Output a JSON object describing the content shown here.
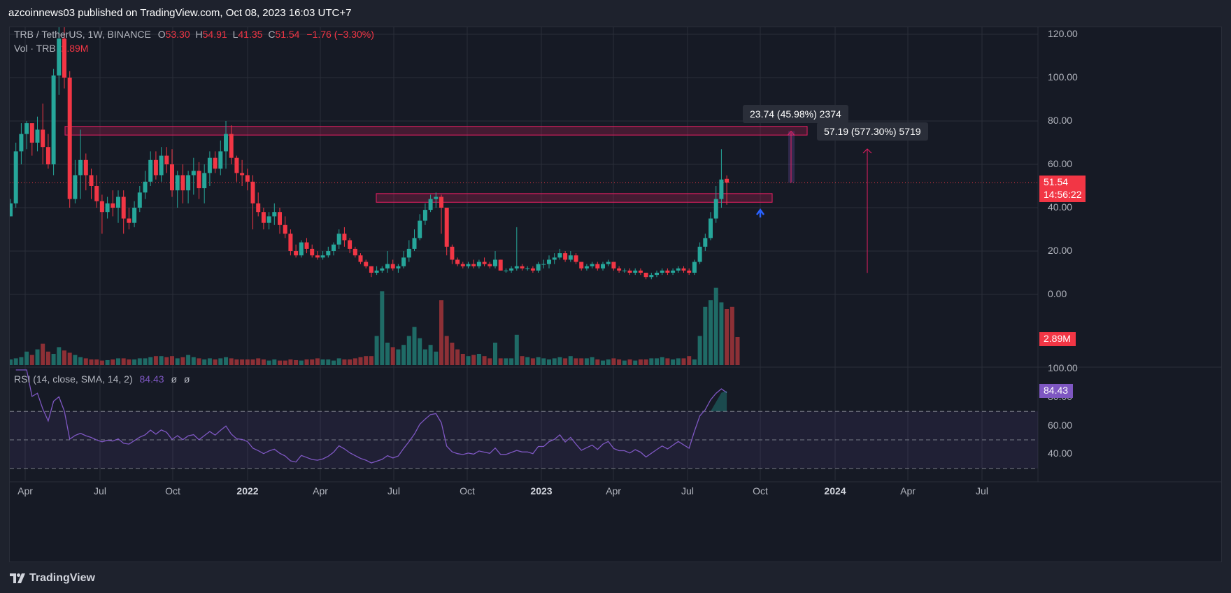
{
  "header": {
    "publisher_text": "azcoinnews03 published on TradingView.com, Oct 08, 2023 16:03 UTC+7"
  },
  "legend": {
    "symbol": "TRB / TetherUS, 1W, BINANCE",
    "o_label": "O",
    "o_value": "53.30",
    "h_label": "H",
    "h_value": "54.91",
    "l_label": "L",
    "l_value": "41.35",
    "c_label": "C",
    "c_value": "51.54",
    "change": "−1.76 (−3.30%)",
    "vol_label": "Vol · TRB",
    "vol_value": "2.89M"
  },
  "rsi_legend": {
    "label": "RSI (14, close, SMA, 14, 2)",
    "value": "84.43",
    "extra1": "ø",
    "extra2": "ø"
  },
  "price_axis": [
    "120.00",
    "100.00",
    "80.00",
    "60.00",
    "40.00",
    "20.00",
    "0.00"
  ],
  "rsi_axis": [
    "100.00",
    "80.00",
    "60.00",
    "40.00"
  ],
  "time_axis": [
    {
      "label": "Apr",
      "bold": false
    },
    {
      "label": "Jul",
      "bold": false
    },
    {
      "label": "Oct",
      "bold": false
    },
    {
      "label": "2022",
      "bold": true
    },
    {
      "label": "Apr",
      "bold": false
    },
    {
      "label": "Jul",
      "bold": false
    },
    {
      "label": "Oct",
      "bold": false
    },
    {
      "label": "2023",
      "bold": true
    },
    {
      "label": "Apr",
      "bold": false
    },
    {
      "label": "Jul",
      "bold": false
    },
    {
      "label": "Oct",
      "bold": false
    },
    {
      "label": "2024",
      "bold": true
    },
    {
      "label": "Apr",
      "bold": false
    },
    {
      "label": "Jul",
      "bold": false
    }
  ],
  "tags": {
    "last_price": "51.54",
    "countdown": "14:56:22",
    "volume": "2.89M",
    "rsi": "84.43"
  },
  "tooltips": {
    "measure1": "23.74 (45.98%) 2374",
    "measure2": "57.19 (577.30%) 5719"
  },
  "footer": {
    "brand": "TradingView"
  },
  "colors": {
    "up": "#26a69a",
    "down": "#f23645",
    "up_vol": "#1f6b66",
    "down_vol": "#8d3036",
    "zone": "#e91e63",
    "rsi_line": "#7e57c2",
    "background": "#161a25"
  },
  "chart_data": {
    "type": "candlestick",
    "symbol": "TRB / TetherUS",
    "interval": "1W",
    "exchange": "BINANCE",
    "price_range": [
      -10,
      125
    ],
    "rsi_range": [
      30,
      100
    ],
    "last": {
      "open": 53.3,
      "high": 54.91,
      "low": 41.35,
      "close": 51.54,
      "change": -1.76,
      "change_pct": -3.3,
      "volume": "2.89M",
      "rsi": 84.43
    },
    "resistance_zones": [
      {
        "low": 73.5,
        "high": 77.5
      },
      {
        "low": 42.5,
        "high": 46.5
      }
    ],
    "measures": [
      {
        "from": 51.54,
        "to": 75.28,
        "change": 23.74,
        "pct": 45.98,
        "label": "23.74 (45.98%) 2374"
      },
      {
        "from": 9.9,
        "to": 67.1,
        "change": 57.19,
        "pct": 577.3,
        "label": "57.19 (577.30%) 5719"
      }
    ],
    "rsi_levels": {
      "upper": 70,
      "middle": 50,
      "lower": 30
    },
    "candles": [
      [
        36,
        44,
        36,
        42
      ],
      [
        42,
        70,
        40,
        66
      ],
      [
        66,
        79,
        60,
        74
      ],
      [
        74,
        80,
        67,
        79
      ],
      [
        79,
        78,
        64,
        70
      ],
      [
        70,
        82,
        66,
        76
      ],
      [
        76,
        88,
        60,
        68
      ],
      [
        68,
        74,
        58,
        60
      ],
      [
        60,
        104,
        55,
        101
      ],
      [
        101,
        125,
        92,
        118
      ],
      [
        118,
        124,
        95,
        100
      ],
      [
        100,
        103,
        40,
        44
      ],
      [
        44,
        62,
        42,
        55
      ],
      [
        55,
        76,
        44,
        62
      ],
      [
        62,
        65,
        48,
        55
      ],
      [
        55,
        58,
        44,
        50
      ],
      [
        50,
        55,
        40,
        43
      ],
      [
        43,
        46,
        28,
        38
      ],
      [
        38,
        45,
        35,
        42
      ],
      [
        42,
        48,
        36,
        40
      ],
      [
        40,
        48,
        33,
        45
      ],
      [
        45,
        48,
        28,
        35
      ],
      [
        35,
        40,
        30,
        33
      ],
      [
        33,
        43,
        31,
        40
      ],
      [
        40,
        50,
        38,
        47
      ],
      [
        47,
        57,
        44,
        52
      ],
      [
        52,
        66,
        50,
        62
      ],
      [
        62,
        66,
        53,
        55
      ],
      [
        55,
        68,
        52,
        64
      ],
      [
        64,
        68,
        56,
        60
      ],
      [
        60,
        67,
        45,
        48
      ],
      [
        48,
        57,
        40,
        55
      ],
      [
        55,
        60,
        42,
        48
      ],
      [
        48,
        57,
        42,
        55
      ],
      [
        55,
        63,
        46,
        57
      ],
      [
        57,
        61,
        44,
        49
      ],
      [
        49,
        60,
        42,
        56
      ],
      [
        56,
        66,
        50,
        63
      ],
      [
        63,
        66,
        56,
        58
      ],
      [
        58,
        71,
        55,
        66
      ],
      [
        66,
        80,
        58,
        74
      ],
      [
        74,
        78,
        60,
        63
      ],
      [
        63,
        64,
        52,
        56
      ],
      [
        56,
        62,
        50,
        55
      ],
      [
        55,
        58,
        48,
        52
      ],
      [
        52,
        55,
        30,
        42
      ],
      [
        42,
        47,
        36,
        38
      ],
      [
        38,
        40,
        30,
        33
      ],
      [
        33,
        38,
        30,
        36
      ],
      [
        36,
        42,
        32,
        38
      ],
      [
        38,
        40,
        28,
        32
      ],
      [
        32,
        36,
        26,
        28
      ],
      [
        28,
        30,
        18,
        20
      ],
      [
        20,
        23,
        17,
        18
      ],
      [
        18,
        25,
        17,
        24
      ],
      [
        24,
        26,
        19,
        21
      ],
      [
        21,
        23,
        17,
        18
      ],
      [
        18,
        20,
        16,
        17
      ],
      [
        17,
        20,
        16,
        18
      ],
      [
        18,
        22,
        17,
        20
      ],
      [
        20,
        24,
        18,
        23
      ],
      [
        23,
        30,
        21,
        28
      ],
      [
        28,
        31,
        22,
        25
      ],
      [
        25,
        26,
        19,
        21
      ],
      [
        21,
        22,
        17,
        18
      ],
      [
        18,
        19,
        14,
        15
      ],
      [
        15,
        16,
        12,
        13
      ],
      [
        13,
        13,
        8,
        10
      ],
      [
        10,
        13,
        9,
        11
      ],
      [
        11,
        13,
        10,
        12
      ],
      [
        12,
        20,
        10,
        14
      ],
      [
        14,
        16,
        11,
        12
      ],
      [
        12,
        14,
        10,
        13
      ],
      [
        13,
        20,
        12,
        17
      ],
      [
        17,
        25,
        15,
        21
      ],
      [
        21,
        30,
        20,
        26
      ],
      [
        26,
        37,
        25,
        34
      ],
      [
        34,
        42,
        32,
        39
      ],
      [
        39,
        46,
        38,
        44
      ],
      [
        44,
        47,
        40,
        45
      ],
      [
        45,
        46,
        28,
        40
      ],
      [
        40,
        40,
        18,
        22
      ],
      [
        22,
        23,
        14,
        16
      ],
      [
        16,
        17,
        13,
        14
      ],
      [
        14,
        15,
        12,
        13
      ],
      [
        13,
        15,
        12,
        14
      ],
      [
        14,
        16,
        12,
        13
      ],
      [
        13,
        16,
        12,
        15
      ],
      [
        15,
        17,
        13,
        14
      ],
      [
        14,
        15,
        12,
        13
      ],
      [
        13,
        20,
        12,
        16
      ],
      [
        16,
        16,
        11,
        11
      ],
      [
        11,
        12,
        10,
        11
      ],
      [
        11,
        13,
        10,
        12
      ],
      [
        12,
        31,
        11,
        13
      ],
      [
        13,
        14,
        11,
        12
      ],
      [
        12,
        13,
        11,
        12
      ],
      [
        12,
        13,
        10,
        11
      ],
      [
        11,
        15,
        10,
        14
      ],
      [
        14,
        16,
        12,
        14
      ],
      [
        14,
        18,
        12,
        16
      ],
      [
        16,
        19,
        14,
        17
      ],
      [
        17,
        21,
        16,
        19
      ],
      [
        19,
        20,
        15,
        16
      ],
      [
        16,
        20,
        15,
        18
      ],
      [
        18,
        19,
        14,
        15
      ],
      [
        15,
        15,
        11,
        12
      ],
      [
        12,
        14,
        11,
        13
      ],
      [
        13,
        15,
        12,
        14
      ],
      [
        14,
        15,
        11,
        12
      ],
      [
        12,
        15,
        11,
        14
      ],
      [
        14,
        16,
        13,
        15
      ],
      [
        15,
        15,
        11,
        12
      ],
      [
        12,
        13,
        10,
        11
      ],
      [
        11,
        12,
        10,
        11
      ],
      [
        11,
        12,
        9,
        10
      ],
      [
        10,
        12,
        9,
        11
      ],
      [
        11,
        12,
        9,
        10
      ],
      [
        10,
        10,
        7,
        8
      ],
      [
        8,
        10,
        7,
        9
      ],
      [
        9,
        11,
        8,
        10
      ],
      [
        10,
        12,
        9,
        11
      ],
      [
        11,
        12,
        9,
        10
      ],
      [
        10,
        12,
        9,
        11
      ],
      [
        11,
        13,
        10,
        12
      ],
      [
        12,
        13,
        10,
        11
      ],
      [
        11,
        12,
        9,
        10
      ],
      [
        10,
        16,
        9,
        15
      ],
      [
        15,
        24,
        14,
        22
      ],
      [
        22,
        28,
        20,
        26
      ],
      [
        26,
        38,
        25,
        35
      ],
      [
        35,
        50,
        33,
        44
      ],
      [
        44,
        67,
        40,
        53
      ],
      [
        53.3,
        54.91,
        41.35,
        51.54
      ]
    ],
    "volumes": [
      0.25,
      0.3,
      0.35,
      0.6,
      0.45,
      0.7,
      0.95,
      0.6,
      0.5,
      0.8,
      0.65,
      0.55,
      0.45,
      0.35,
      0.3,
      0.25,
      0.25,
      0.2,
      0.22,
      0.25,
      0.3,
      0.3,
      0.25,
      0.25,
      0.3,
      0.3,
      0.35,
      0.4,
      0.4,
      0.35,
      0.4,
      0.3,
      0.35,
      0.45,
      0.35,
      0.3,
      0.25,
      0.3,
      0.25,
      0.3,
      0.35,
      0.3,
      0.25,
      0.25,
      0.25,
      0.25,
      0.3,
      0.25,
      0.2,
      0.25,
      0.2,
      0.2,
      0.25,
      0.22,
      0.2,
      0.25,
      0.25,
      0.3,
      0.25,
      0.25,
      0.2,
      0.3,
      0.25,
      0.25,
      0.3,
      0.35,
      0.4,
      0.4,
      1.3,
      3.3,
      1.0,
      0.8,
      0.7,
      0.9,
      1.3,
      1.7,
      1.2,
      0.7,
      0.9,
      0.6,
      2.9,
      1.3,
      1.0,
      0.7,
      0.5,
      0.4,
      0.45,
      0.5,
      0.4,
      0.3,
      1.0,
      0.3,
      0.3,
      0.3,
      1.35,
      0.4,
      0.35,
      0.3,
      0.35,
      0.3,
      0.25,
      0.3,
      0.35,
      0.3,
      0.4,
      0.3,
      0.3,
      0.3,
      0.35,
      0.25,
      0.2,
      0.25,
      0.3,
      0.25,
      0.2,
      0.25,
      0.2,
      0.25,
      0.25,
      0.3,
      0.3,
      0.35,
      0.3,
      0.25,
      0.3,
      0.3,
      0.4,
      0.25,
      1.3,
      2.6,
      2.9,
      3.45,
      2.8,
      2.5,
      2.6,
      1.25
    ]
  }
}
